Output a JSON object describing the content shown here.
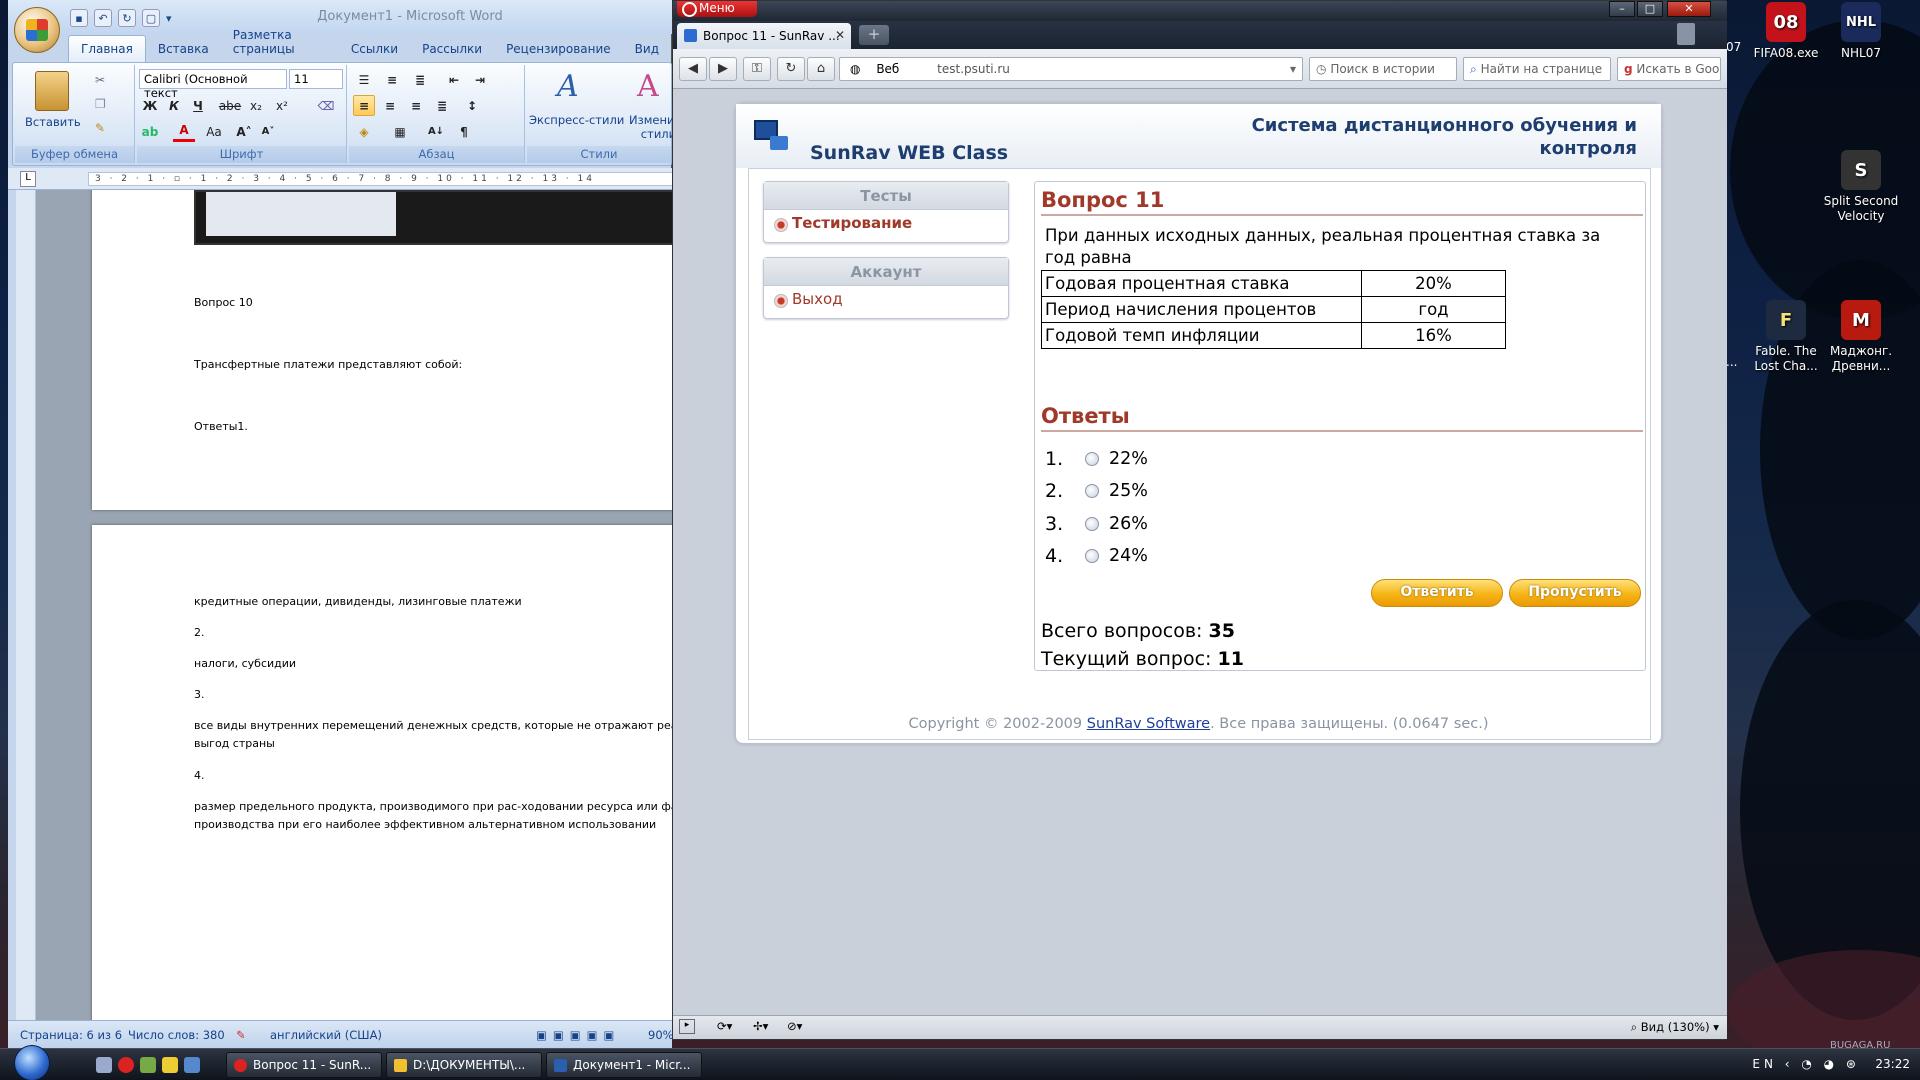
{
  "desktop": {
    "icons": [
      {
        "label": "FIFA08.exe",
        "badge": "08",
        "color": "#c4121a"
      },
      {
        "label": "NHL07",
        "badge": "NHL",
        "color": "#1a2a5a"
      },
      {
        "label": "Split Second Velocity",
        "badge": "S",
        "color": "#333"
      },
      {
        "label": "Fable. The Lost Cha...",
        "badge": "F",
        "color": "#1e2a40"
      },
      {
        "label": "Маджонг. Древни...",
        "badge": "M",
        "color": "#b81a10"
      }
    ],
    "partial_labels": [
      "07",
      "..."
    ],
    "watermark": "BUGAGA.RU"
  },
  "word": {
    "title": "Документ1 - Microsoft Word",
    "tabs": [
      "Главная",
      "Вставка",
      "Разметка страницы",
      "Ссылки",
      "Рассылки",
      "Рецензирование",
      "Вид"
    ],
    "active_tab": "Главная",
    "ribbon": {
      "paste_label": "Вставить",
      "font_name": "Calibri (Основной текст",
      "font_size": "11",
      "bold": "Ж",
      "italic": "К",
      "underline": "Ч",
      "strike": "abe",
      "sub": "x₂",
      "sup": "x²",
      "font_color_glyph": "A",
      "case_glyph": "Aa",
      "grow_glyph": "A˄",
      "shrink_glyph": "A˅",
      "pilcrow": "¶",
      "sort_glyph": "A↓",
      "quick_styles": "Экспресс-стили",
      "change_styles_line1": "Изменить",
      "change_styles_line2": "стили",
      "groups": [
        "Буфер обмена",
        "Шрифт",
        "Абзац",
        "Стили"
      ]
    },
    "ruler_text": "3 · 2 · 1 · ▫ · 1 · 2 · 3 · 4 · 5 · 6 · 7 · 8 · 9 · 10 · 11 · 12 · 13 · 14",
    "page1": [
      "Вопрос 10",
      "Трансфертные платежи представляют собой:",
      "Ответы1."
    ],
    "page2": [
      "кредитные операции, дивиденды, лизинговые платежи",
      "2.",
      "налоги, субсидии",
      "3.",
      "все виды внутренних перемещений денежных средств, которые не отражают реальных",
      "выгод страны",
      "4.",
      "размер предельного продукта, производимого при рас-ходовании ресурса или фактора",
      "производства при его наиболее эффективном альтернативном использовании"
    ],
    "status": {
      "page": "Страница: 6 из 6",
      "words": "Число слов: 380",
      "lang": "английский (США)",
      "zoom": "90%"
    }
  },
  "opera": {
    "menu_label": "Меню",
    "tab_title": "Вопрос 11 - SunRav ...",
    "tab_close": "✕",
    "newtab_glyph": "+",
    "address_prefix": "Веб",
    "address": "test.psuti.ru",
    "history_search": "Поиск в истории",
    "find_on_page": "Найти на странице",
    "google_search": "Искать в Google",
    "zoom_label": "Вид (130%)",
    "controls": {
      "minimize": "–",
      "maximize": "□",
      "close": "✕"
    }
  },
  "sunrav": {
    "brand": "SunRav WEB Class",
    "system_title": "Система дистанционного обучения и контроля",
    "sidebar": {
      "tests_header": "Тесты",
      "tests_item": "Тестирование",
      "account_header": "Аккаунт",
      "account_item": "Выход"
    },
    "question": {
      "heading": "Вопрос 11",
      "text": "При данных исходных данных, реальная процентная ставка за год равна",
      "table": [
        [
          "Годовая процентная ставка",
          "20%"
        ],
        [
          "Период начисления процентов",
          "год"
        ],
        [
          "Годовой темп инфляции",
          "16%"
        ]
      ],
      "answers_heading": "Ответы",
      "answers": [
        {
          "num": "1.",
          "text": "22%"
        },
        {
          "num": "2.",
          "text": "25%"
        },
        {
          "num": "3.",
          "text": "26%"
        },
        {
          "num": "4.",
          "text": "24%"
        }
      ],
      "answer_button": "Ответить",
      "skip_button": "Пропустить",
      "total_label": "Всего вопросов:",
      "total_value": "35",
      "current_label": "Текущий вопрос:",
      "current_value": "11"
    },
    "footer": {
      "prefix": "Copyright © 2002-2009 ",
      "link": "SunRav Software",
      "suffix": ". Все права защищены. (0.0647 sec.)"
    }
  },
  "taskbar": {
    "buttons": [
      {
        "label": "Вопрос 11 - SunR...",
        "color": "#d22"
      },
      {
        "label": "D:\\ДОКУМЕНТЫ\\...",
        "color": "#f0c030"
      },
      {
        "label": "Документ1 - Micr...",
        "color": "#2a5fb0"
      }
    ],
    "tray": "EN ‹ ◔ ◕ ⊛",
    "clock": "23:22"
  }
}
